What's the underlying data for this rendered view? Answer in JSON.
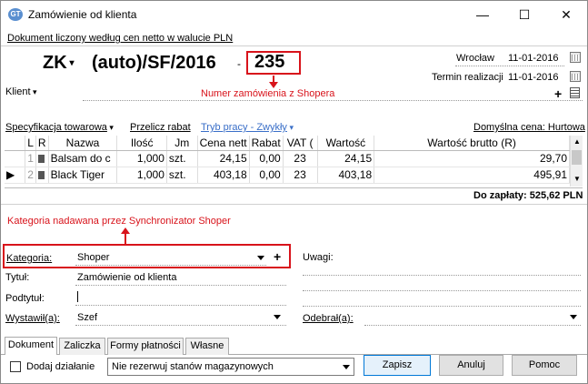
{
  "window": {
    "title": "Zamówienie od klienta",
    "icon_text": "GT",
    "minimize": "—",
    "maximize": "☐",
    "close": "✕"
  },
  "banner": "Dokument liczony według cen netto w walucie PLN",
  "header": {
    "doc_type": "ZK",
    "doc_series": "(auto)/SF/2016",
    "dash": "-",
    "doc_number": "235",
    "city": "Wrocław",
    "date": "11-01-2016",
    "termin_label": "Termin realizacji",
    "termin_date": "11-01-2016"
  },
  "client": {
    "label": "Klient"
  },
  "annotations": {
    "order_number": "Numer zamówienia z Shopera",
    "category": "Kategoria nadawana przez Synchronizator Shoper"
  },
  "toolbar": {
    "spec_label": "Specyfikacja towarowa",
    "przelicz": "Przelicz rabat",
    "tryb": "Tryb pracy - Zwykły",
    "cena": "Domyślna cena: Hurtowa"
  },
  "grid": {
    "columns": [
      "L",
      "R",
      "Nazwa",
      "Ilość",
      "Jm",
      "Cena nett",
      "Rabat",
      "VAT (",
      "Wartość",
      "Wartość brutto (R)"
    ],
    "rows": [
      {
        "lp": "1",
        "nazwa": "Balsam do c",
        "ilosc": "1,000",
        "jm": "szt.",
        "cena": "24,15",
        "rabat": "0,00",
        "vat": "23",
        "wartosc": "24,15",
        "brutto": "29,70"
      },
      {
        "lp": "2",
        "nazwa": "Black Tiger",
        "ilosc": "1,000",
        "jm": "szt.",
        "cena": "403,18",
        "rabat": "0,00",
        "vat": "23",
        "wartosc": "403,18",
        "brutto": "495,91"
      }
    ]
  },
  "total": "Do zapłaty: 525,62 PLN",
  "form": {
    "kategoria_label": "Kategoria:",
    "kategoria_value": "Shoper",
    "tytul_label": "Tytuł:",
    "tytul_value": "Zamówienie od klienta",
    "podtytul_label": "Podtytuł:",
    "wystawil_label": "Wystawił(a):",
    "wystawil_value": "Szef",
    "uwagi_label": "Uwagi:",
    "odebral_label": "Odebrał(a):"
  },
  "tabs": [
    "Dokument",
    "Zaliczka",
    "Formy płatności",
    "Własne"
  ],
  "footer": {
    "dodaj": "Dodaj działanie",
    "rezerwacja": "Nie rezerwuj stanów magazynowych",
    "zapisz": "Zapisz",
    "anuluj": "Anuluj",
    "pomoc": "Pomoc"
  }
}
